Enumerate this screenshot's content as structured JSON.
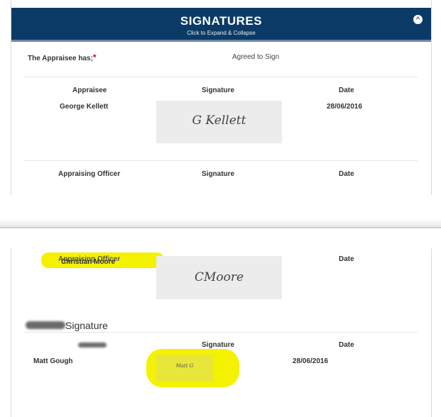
{
  "header": {
    "title": "SIGNATURES",
    "subtitle": "Click to Expand & Collapse",
    "toggle_icon": "chevron-up-icon"
  },
  "appraisee_status": {
    "label": "The Appraisee has;",
    "required_mark": "*",
    "value": "Agreed to Sign"
  },
  "appraisee_row": {
    "col1_header": "Appraisee",
    "col2_header": "Signature",
    "col3_header": "Date",
    "name": "George Kellett",
    "signature": "G Kellett",
    "date": "28/06/2016"
  },
  "officer_row": {
    "col1_header": "Appraising Officer",
    "col2_header": "Signature",
    "col3_header": "Date"
  },
  "officer_row_2": {
    "col1_header": "Appraising Officer",
    "col3_header": "Date",
    "name": "Christian Moore",
    "signature": "CMoore"
  },
  "third_section": {
    "title": "Signature",
    "col2_header": "Signature",
    "col3_header": "Date",
    "name": "Matt Gough",
    "signature": "Matt G",
    "date": "28/06/2016"
  },
  "colors": {
    "header_bg": "#0b3a66",
    "highlight": "#f5f200",
    "required": "#d0021b"
  }
}
